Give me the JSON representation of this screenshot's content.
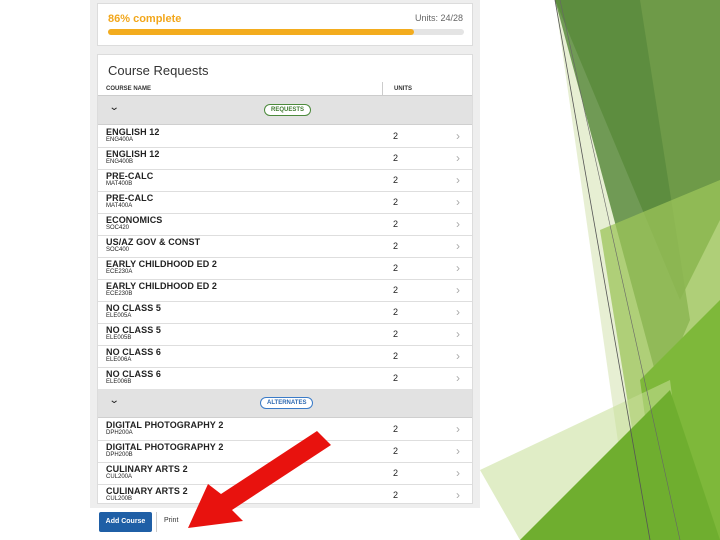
{
  "progress": {
    "label": "86% complete",
    "percent": 86,
    "units_text": "Units: 24/28",
    "bar_color": "#f3ac1e"
  },
  "course_requests": {
    "title": "Course Requests",
    "col_course": "COURSE NAME",
    "col_units": "UNITS",
    "requests": {
      "badge": "REQUESTS",
      "items": [
        {
          "name": "ENGLISH 12",
          "code": "ENG400A",
          "units": "2"
        },
        {
          "name": "ENGLISH 12",
          "code": "ENG400B",
          "units": "2"
        },
        {
          "name": "PRE-CALC",
          "code": "MAT400B",
          "units": "2"
        },
        {
          "name": "PRE-CALC",
          "code": "MAT400A",
          "units": "2"
        },
        {
          "name": "ECONOMICS",
          "code": "SOC420",
          "units": "2"
        },
        {
          "name": "US/AZ GOV & CONST",
          "code": "SOC400",
          "units": "2"
        },
        {
          "name": "EARLY CHILDHOOD ED 2",
          "code": "ECE230A",
          "units": "2"
        },
        {
          "name": "EARLY CHILDHOOD ED 2",
          "code": "ECE230B",
          "units": "2"
        },
        {
          "name": "NO CLASS 5",
          "code": "ELE005A",
          "units": "2"
        },
        {
          "name": "NO CLASS 5",
          "code": "ELE005B",
          "units": "2"
        },
        {
          "name": "NO CLASS 6",
          "code": "ELE006A",
          "units": "2"
        },
        {
          "name": "NO CLASS 6",
          "code": "ELE006B",
          "units": "2"
        }
      ]
    },
    "alternates": {
      "badge": "ALTERNATES",
      "items": [
        {
          "name": "DIGITAL PHOTOGRAPHY 2",
          "code": "DPH200A",
          "units": "2"
        },
        {
          "name": "DIGITAL PHOTOGRAPHY 2",
          "code": "DPH200B",
          "units": "2"
        },
        {
          "name": "CULINARY ARTS 2",
          "code": "CUL200A",
          "units": "2"
        },
        {
          "name": "CULINARY ARTS 2",
          "code": "CUL200B",
          "units": "2"
        }
      ]
    }
  },
  "actions": {
    "add_course": "Add Course",
    "print": "Print"
  },
  "colors": {
    "add_button": "#1f5fa6",
    "arrow": "#e8120e",
    "requests_badge": "#4c8a3c",
    "alternates_badge": "#3a7bc8"
  },
  "icons": {
    "group_toggle": "chevron-down-icon",
    "row_open": "chevron-right-icon"
  }
}
